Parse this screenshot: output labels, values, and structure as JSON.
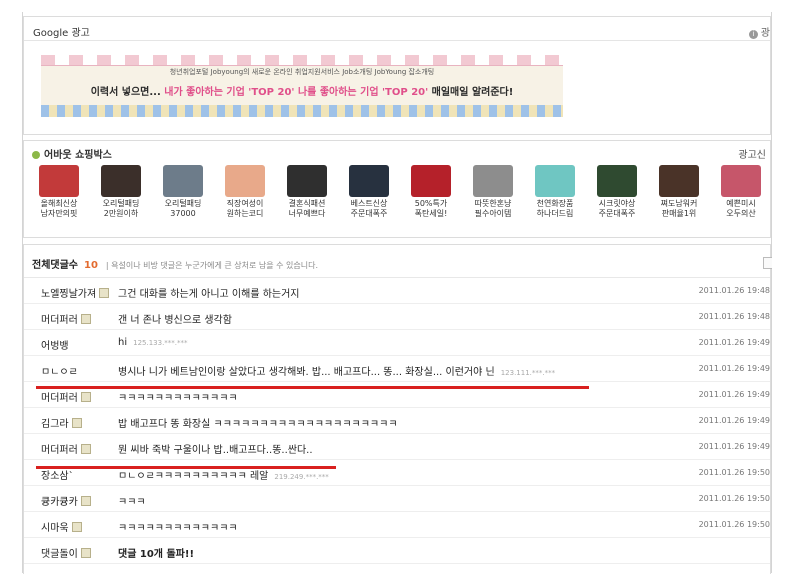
{
  "google_ads": {
    "title": "Google 광고",
    "ad_info": "광",
    "banner": {
      "small_text": "청년취업포털 Jobyoung의 새로운 온라인 취업지원서비스 Job소개팅 JobYoung 잡소개팅",
      "main_1": "이력서 넣으면...",
      "main_2": "내가 좋아하는 기업 'TOP 20'",
      "main_3": "나를 좋아하는 기업 'TOP 20'",
      "main_4": "매일매일 알려준다!"
    }
  },
  "shopping": {
    "title": "어바웃 쇼핑박스",
    "ad_info": "광고신",
    "items": [
      {
        "l1": "올해최신상",
        "l2": "남자만의핏",
        "color": "#c23a3a"
      },
      {
        "l1": "오리털패딩",
        "l2": "2만원이하",
        "color": "#3b2f2a"
      },
      {
        "l1": "오리털패딩",
        "l2": "37000",
        "color": "#6d7c8a"
      },
      {
        "l1": "직장여성이",
        "l2": "원하는코디",
        "color": "#e8a98a"
      },
      {
        "l1": "결혼식패션",
        "l2": "너무예쁘다",
        "color": "#2f2f2f"
      },
      {
        "l1": "베스트신상",
        "l2": "주문대폭주",
        "color": "#27313f"
      },
      {
        "l1": "50%특가",
        "l2": "폭탄세일!",
        "color": "#b5212a"
      },
      {
        "l1": "따뜻한혼냥",
        "l2": "필수아이템",
        "color": "#8d8d8d"
      },
      {
        "l1": "천연화장품",
        "l2": "하나더드림",
        "color": "#6fc6c2"
      },
      {
        "l1": "시크릿야상",
        "l2": "주문대폭주",
        "color": "#2f4a30"
      },
      {
        "l1": "쪄도남워커",
        "l2": "판매율1위",
        "color": "#4a3328"
      },
      {
        "l1": "예쁜미시",
        "l2": "오두의산",
        "color": "#c6566a"
      }
    ]
  },
  "comments": {
    "header": "전체댓글수",
    "count": "10",
    "note": "| 욕설이나 비방 댓글은 누군가에게 큰 상처로 남을 수 있습니다.",
    "rows": [
      {
        "nick": "노엘찡날가져",
        "text": "그건 대화를 하는게 아니고 이해를 하는거지",
        "ip": "",
        "date": "2011.01.26 19:48",
        "badge": true
      },
      {
        "nick": "머더퍼러",
        "text": "갠 너 존나 병신으로 생각함",
        "ip": "",
        "date": "2011.01.26 19:48",
        "badge": true
      },
      {
        "nick": "어벙뱅",
        "text": "hi",
        "ip": "125.133.***.***",
        "date": "2011.01.26 19:49",
        "badge": false
      },
      {
        "nick": "ㅁㄴㅇㄹ",
        "text": "병시나 니가 베트남인이랑 살았다고 생각해봐. 밥... 배고프다... 똥... 화장실... 이런거야 닌",
        "ip": "123.111.***.***",
        "date": "2011.01.26 19:49",
        "badge": false
      },
      {
        "nick": "머더퍼러",
        "text": "ㅋㅋㅋㅋㅋㅋㅋㅋㅋㅋㅋㅋㅋ",
        "ip": "",
        "date": "2011.01.26 19:49",
        "badge": true
      },
      {
        "nick": "김그라",
        "text": "밥 배고프다 똥 화장실 ㅋㅋㅋㅋㅋㅋㅋㅋㅋㅋㅋㅋㅋㅋㅋㅋㅋㅋㅋㅋ",
        "ip": "",
        "date": "2011.01.26 19:49",
        "badge": true
      },
      {
        "nick": "머더퍼러",
        "text": "뭔 씨바 죽박 구울이나 밥..배고프다..똥..싼다..",
        "ip": "",
        "date": "2011.01.26 19:49",
        "badge": true
      },
      {
        "nick": "장소삼`",
        "text": "ㅁㄴㅇㄹㅋㅋㅋㅋㅋㅋㅋㅋㅋㅋ 레알",
        "ip": "219.249.***.***",
        "date": "2011.01.26 19:50",
        "badge": false
      },
      {
        "nick": "큥카큥카",
        "text": "ㅋㅋㅋ",
        "ip": "",
        "date": "2011.01.26 19:50",
        "badge": true
      },
      {
        "nick": "시마욱",
        "text": "ㅋㅋㅋㅋㅋㅋㅋㅋㅋㅋㅋㅋㅋ",
        "ip": "",
        "date": "2011.01.26 19:50",
        "badge": true
      },
      {
        "nick": "댓글돌이",
        "text": "댓글 10개 돌파!!",
        "ip": "",
        "date": "",
        "badge": true
      }
    ]
  }
}
